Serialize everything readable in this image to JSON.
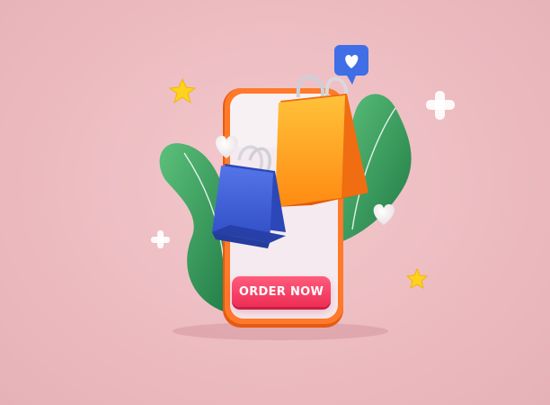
{
  "cta": {
    "label": "ORDER NOW"
  },
  "colors": {
    "background": "#eab8bd",
    "phone_frame": "#f26b1d",
    "phone_screen": "#f4e9ee",
    "leaf": "#2f9a5a",
    "bag_blue": "#3c5ccf",
    "bag_orange": "#ff9b1a",
    "button": "#ee2d55",
    "chat_bubble": "#3f6ee6",
    "star": "#ffd21f"
  },
  "icons": [
    "heart-chat-bubble-icon",
    "star-icon",
    "plus-icon",
    "heart-icon",
    "shopping-bag-icon"
  ]
}
